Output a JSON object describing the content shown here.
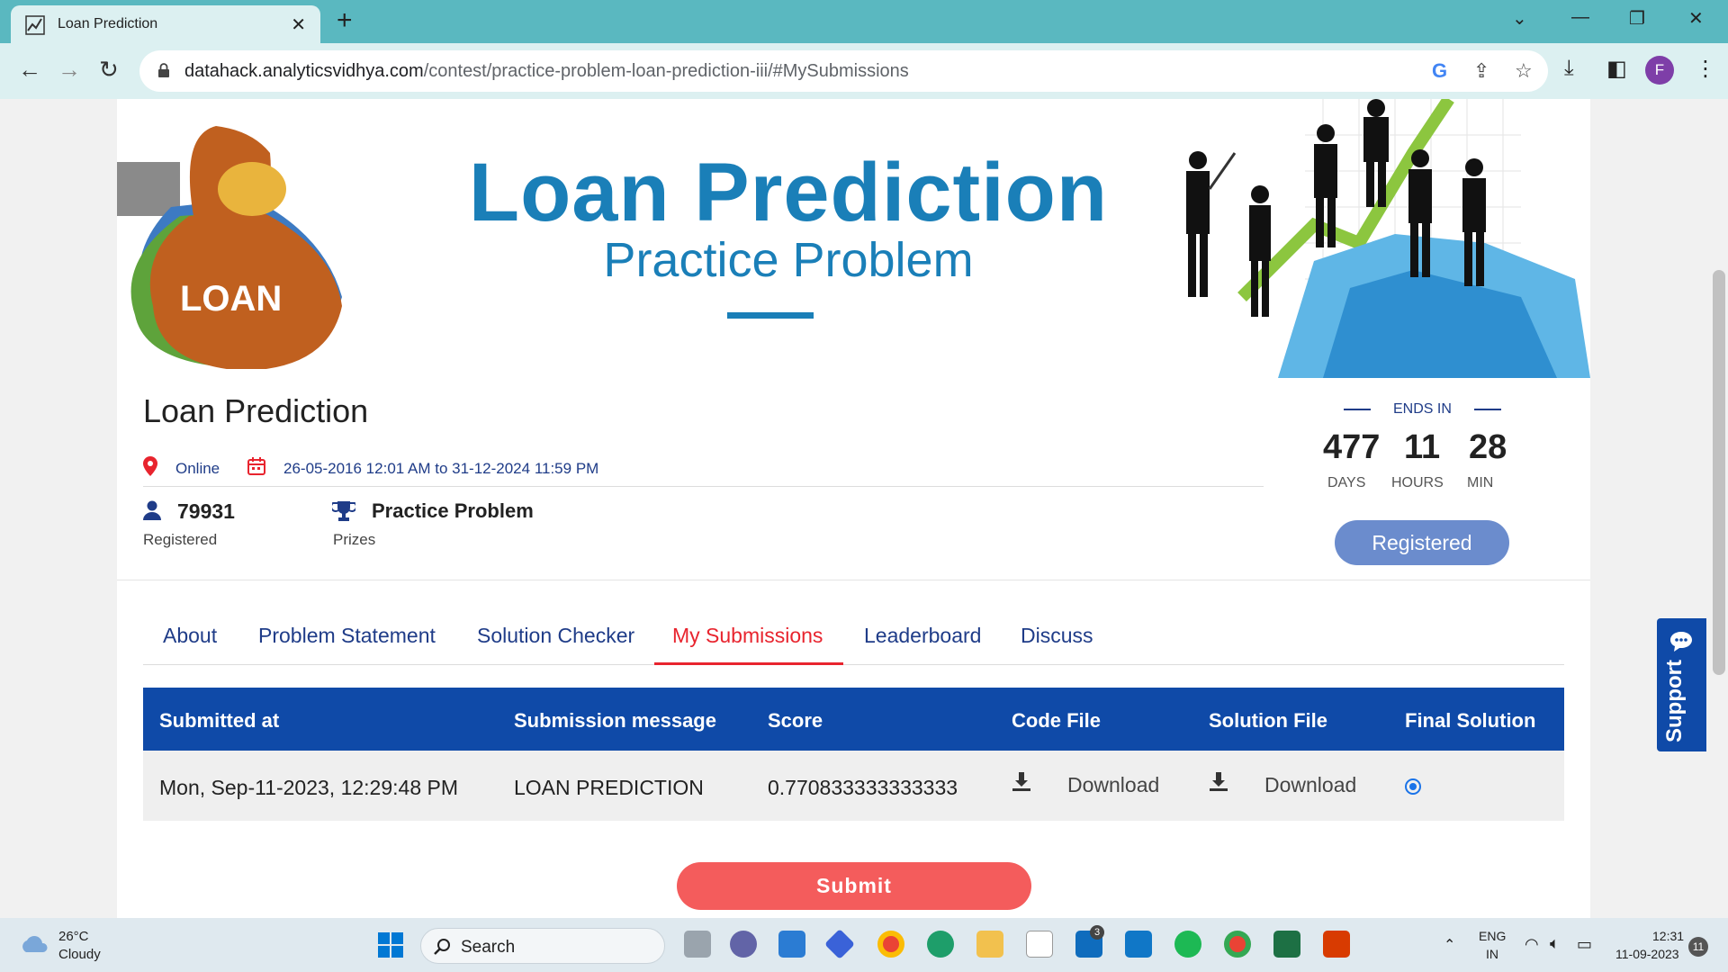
{
  "browser": {
    "tab_title": "Loan Prediction",
    "tab_close": "✕",
    "new_tab": "+",
    "url_domain": "datahack.analyticsvidhya.com",
    "url_path": "/contest/practice-problem-loan-prediction-iii/#MySubmissions",
    "profile_initial": "F"
  },
  "banner": {
    "title": "Loan Prediction",
    "subtitle": "Practice Problem",
    "bag_label": "LOAN"
  },
  "contest": {
    "title": "Loan Prediction",
    "location": "Online",
    "dates": "26-05-2016 12:01 AM to 31-12-2024 11:59 PM",
    "registered_count": "79931",
    "registered_label": "Registered",
    "prize_text": "Practice Problem",
    "prize_label": "Prizes"
  },
  "countdown": {
    "label": "ENDS IN",
    "days": "477",
    "hours": "11",
    "minutes": "28",
    "days_label": "DAYS",
    "hours_label": "HOURS",
    "minutes_label": "MIN"
  },
  "registered_button": "Registered",
  "tabs": [
    {
      "label": "About"
    },
    {
      "label": "Problem Statement"
    },
    {
      "label": "Solution Checker"
    },
    {
      "label": "My Submissions",
      "active": true
    },
    {
      "label": "Leaderboard"
    },
    {
      "label": "Discuss"
    }
  ],
  "table": {
    "headers": [
      "Submitted at",
      "Submission message",
      "Score",
      "Code File",
      "Solution File",
      "Final Solution"
    ],
    "rows": [
      {
        "submitted_at": "Mon, Sep-11-2023, 12:29:48 PM",
        "message": "LOAN PREDICTION",
        "score": "0.770833333333333",
        "code_file": "Download",
        "solution_file": "Download",
        "final_solution": true
      }
    ]
  },
  "submit_button": "Submit",
  "support_label": "Support",
  "taskbar": {
    "weather_temp": "26°C",
    "weather_cond": "Cloudy",
    "search_label": "Search",
    "mail_badge": "3",
    "lang1": "ENG",
    "lang2": "IN",
    "time": "12:31",
    "date": "11-09-2023",
    "notifications": "11"
  },
  "colors": {
    "accent_blue": "#0f4aa8",
    "active_tab_red": "#e8242e",
    "submit_red": "#f45c5c",
    "registered_btn": "#6b8ccd",
    "banner_blue": "#1a7fb8"
  }
}
